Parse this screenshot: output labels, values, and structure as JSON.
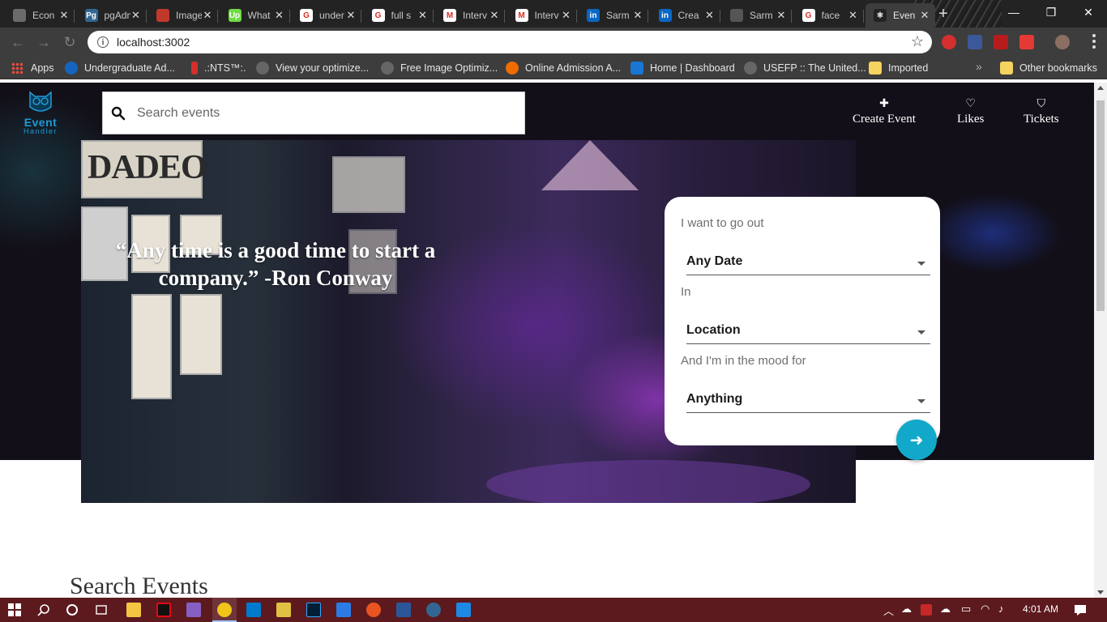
{
  "browser": {
    "tabs": [
      {
        "title": "Econ",
        "fav_color": "#6b6b6b",
        "fav_text": ""
      },
      {
        "title": "pgAdmin",
        "fav_color": "#336791",
        "fav_text": "Pg"
      },
      {
        "title": "Image",
        "fav_color": "#c0392b",
        "fav_text": ""
      },
      {
        "title": "What",
        "fav_color": "#6fda44",
        "fav_text": "Up"
      },
      {
        "title": "under",
        "fav_color": "#ffffff",
        "fav_text": "G"
      },
      {
        "title": "full s",
        "fav_color": "#ffffff",
        "fav_text": "G"
      },
      {
        "title": "Interv",
        "fav_color": "#ffffff",
        "fav_text": "M"
      },
      {
        "title": "Interv",
        "fav_color": "#ffffff",
        "fav_text": "M"
      },
      {
        "title": "Sarm",
        "fav_color": "#0a66c2",
        "fav_text": "in"
      },
      {
        "title": "Crea",
        "fav_color": "#0a66c2",
        "fav_text": "in"
      },
      {
        "title": "Sarm",
        "fav_color": "#555555",
        "fav_text": ""
      },
      {
        "title": "face",
        "fav_color": "#ffffff",
        "fav_text": "G"
      },
      {
        "title": "Even",
        "fav_color": "#222222",
        "fav_text": "⚛"
      }
    ],
    "url": "localhost:3002",
    "bookmarks": [
      {
        "label": "Apps"
      },
      {
        "label": "Undergraduate Ad..."
      },
      {
        "label": ".:NTS™:."
      },
      {
        "label": "View your optimize..."
      },
      {
        "label": "Free Image Optimiz..."
      },
      {
        "label": "Online Admission A..."
      },
      {
        "label": "Home | Dashboard"
      },
      {
        "label": "USEFP :: The United..."
      },
      {
        "label": "Imported"
      },
      {
        "label": "Other bookmarks"
      }
    ]
  },
  "app": {
    "logo": {
      "line1": "Event",
      "line2": "Handler"
    },
    "search": {
      "placeholder": "Search events",
      "value": ""
    },
    "nav": [
      {
        "label": "Create Event",
        "icon": "plus-icon"
      },
      {
        "label": "Likes",
        "icon": "heart-icon"
      },
      {
        "label": "Tickets",
        "icon": "ticket-icon"
      }
    ],
    "hero": {
      "quote": "“Any time is a good time to start a company.” -Ron Conway"
    },
    "filter": {
      "label_when": "I want to go out",
      "date_value": "Any Date",
      "label_where": "In",
      "location_value": "Location",
      "label_mood": "And I'm in the mood for",
      "mood_value": "Anything"
    },
    "section_title": "Search Events"
  },
  "taskbar": {
    "time": "4:01 AM"
  }
}
